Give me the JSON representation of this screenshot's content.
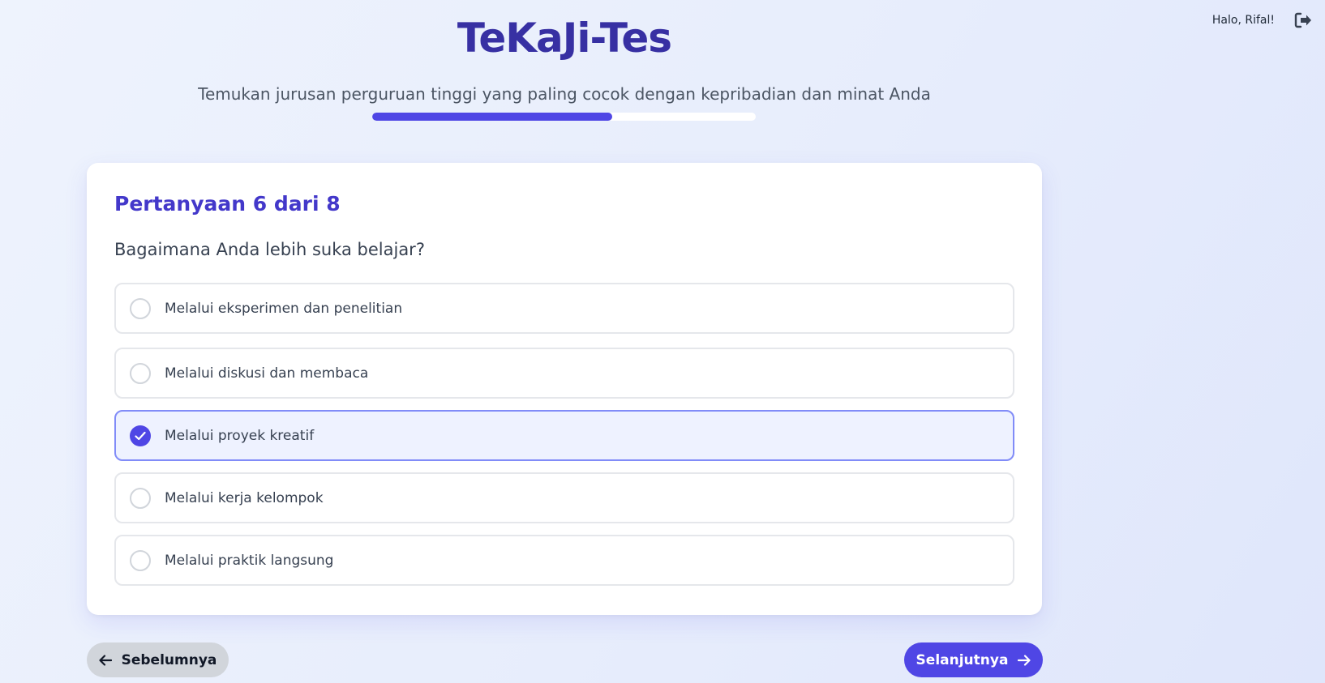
{
  "user": {
    "greeting": "Halo, Rifal!",
    "logout_icon": "logout-icon"
  },
  "header": {
    "title": "TeKaJi-Tes",
    "subtitle": "Temukan jurusan perguruan tinggi yang paling cocok dengan kepribadian dan minat Anda"
  },
  "progress": {
    "fraction": 0.625
  },
  "question": {
    "counter": "Pertanyaan 6 dari 8",
    "text": "Bagaimana Anda lebih suka belajar?",
    "options": [
      {
        "label": "Melalui eksperimen dan penelitian",
        "selected": false
      },
      {
        "label": "Melalui diskusi dan membaca",
        "selected": false
      },
      {
        "label": "Melalui proyek kreatif",
        "selected": true
      },
      {
        "label": "Melalui kerja kelompok",
        "selected": false
      },
      {
        "label": "Melalui praktik langsung",
        "selected": false
      }
    ]
  },
  "navigation": {
    "prev_label": "Sebelumnya",
    "next_label": "Selanjutnya",
    "prev_icon": "arrow-left-icon",
    "next_icon": "arrow-right-icon"
  },
  "colors": {
    "primary": "#4f46e5",
    "title": "#3730a3",
    "selected_bg": "#eef2ff",
    "selected_border": "#818cf8"
  }
}
